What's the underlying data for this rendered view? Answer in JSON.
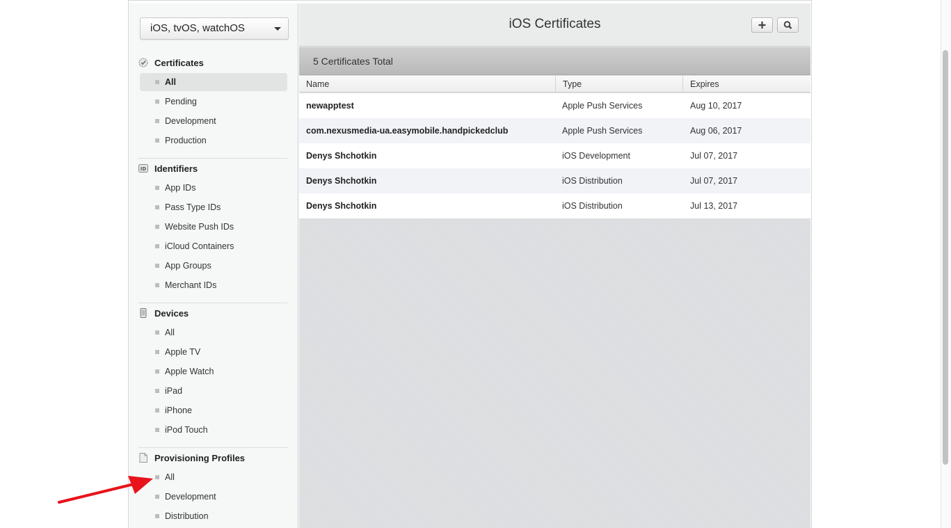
{
  "platform_select": {
    "value": "iOS, tvOS, watchOS"
  },
  "sidebar": {
    "certificates": {
      "title": "Certificates",
      "items": [
        {
          "label": "All",
          "active": true
        },
        {
          "label": "Pending"
        },
        {
          "label": "Development"
        },
        {
          "label": "Production"
        }
      ]
    },
    "identifiers": {
      "title": "Identifiers",
      "icon_text": "ID",
      "items": [
        {
          "label": "App IDs"
        },
        {
          "label": "Pass Type IDs"
        },
        {
          "label": "Website Push IDs"
        },
        {
          "label": "iCloud Containers"
        },
        {
          "label": "App Groups"
        },
        {
          "label": "Merchant IDs"
        }
      ]
    },
    "devices": {
      "title": "Devices",
      "items": [
        {
          "label": "All"
        },
        {
          "label": "Apple TV"
        },
        {
          "label": "Apple Watch"
        },
        {
          "label": "iPad"
        },
        {
          "label": "iPhone"
        },
        {
          "label": "iPod Touch"
        }
      ]
    },
    "provisioning": {
      "title": "Provisioning Profiles",
      "items": [
        {
          "label": "All"
        },
        {
          "label": "Development"
        },
        {
          "label": "Distribution"
        }
      ]
    }
  },
  "main": {
    "title": "iOS Certificates",
    "add_icon": "plus-icon",
    "search_icon": "search-icon",
    "totals": "5 Certificates Total",
    "columns": [
      "Name",
      "Type",
      "Expires"
    ],
    "rows": [
      {
        "name": "newapptest",
        "type": "Apple Push Services",
        "expires": "Aug 10, 2017"
      },
      {
        "name": "com.nexusmedia-ua.easymobile.handpickedclub",
        "type": "Apple Push Services",
        "expires": "Aug 06, 2017"
      },
      {
        "name": "Denys Shchotkin",
        "type": "iOS Development",
        "expires": "Jul 07, 2017"
      },
      {
        "name": "Denys Shchotkin",
        "type": "iOS Distribution",
        "expires": "Jul 07, 2017"
      },
      {
        "name": "Denys Shchotkin",
        "type": "iOS Distribution",
        "expires": "Jul 13, 2017"
      }
    ]
  },
  "annotation": {
    "arrow_color": "#e8131b"
  }
}
